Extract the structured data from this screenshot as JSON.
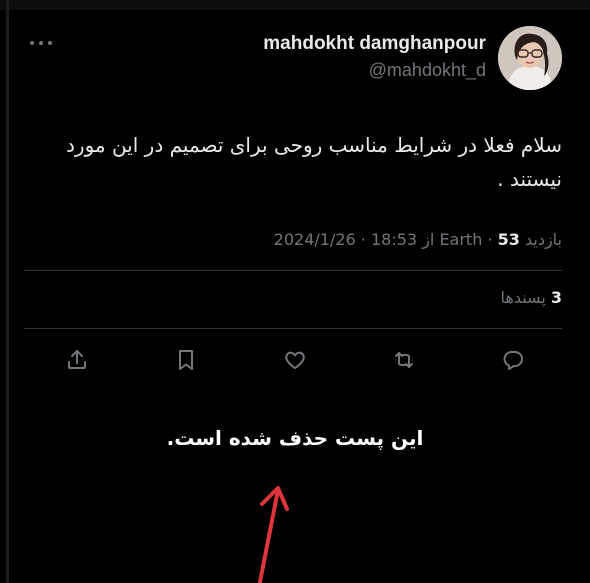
{
  "post": {
    "author": {
      "display_name": "mahdokht damghanpour",
      "handle": "@mahdokht_d",
      "avatar_icon": "user-avatar-photo"
    },
    "text": "سلام فعلا در شرایط مناسب روحی برای تصمیم در این مورد نیستند .",
    "meta": {
      "date": "2024/1/26",
      "separator": " · ",
      "time": "18:53",
      "from_word": "از",
      "location": "Earth",
      "views_count": "53",
      "views_label": "بازدید"
    },
    "likes": {
      "count": "3",
      "label": "پسندها"
    },
    "actions": [
      {
        "name": "share-icon",
        "label": "Share"
      },
      {
        "name": "bookmark-icon",
        "label": "Bookmark"
      },
      {
        "name": "like-icon",
        "label": "Like"
      },
      {
        "name": "repost-icon",
        "label": "Repost"
      },
      {
        "name": "reply-icon",
        "label": "Reply"
      }
    ]
  },
  "notice": {
    "text": "این پست حذف شده است."
  },
  "colors": {
    "background": "#000000",
    "primary_text": "#e7e9ea",
    "secondary_text": "#71767b",
    "divider": "#2f3336",
    "annotation_arrow": "#e0343d"
  }
}
